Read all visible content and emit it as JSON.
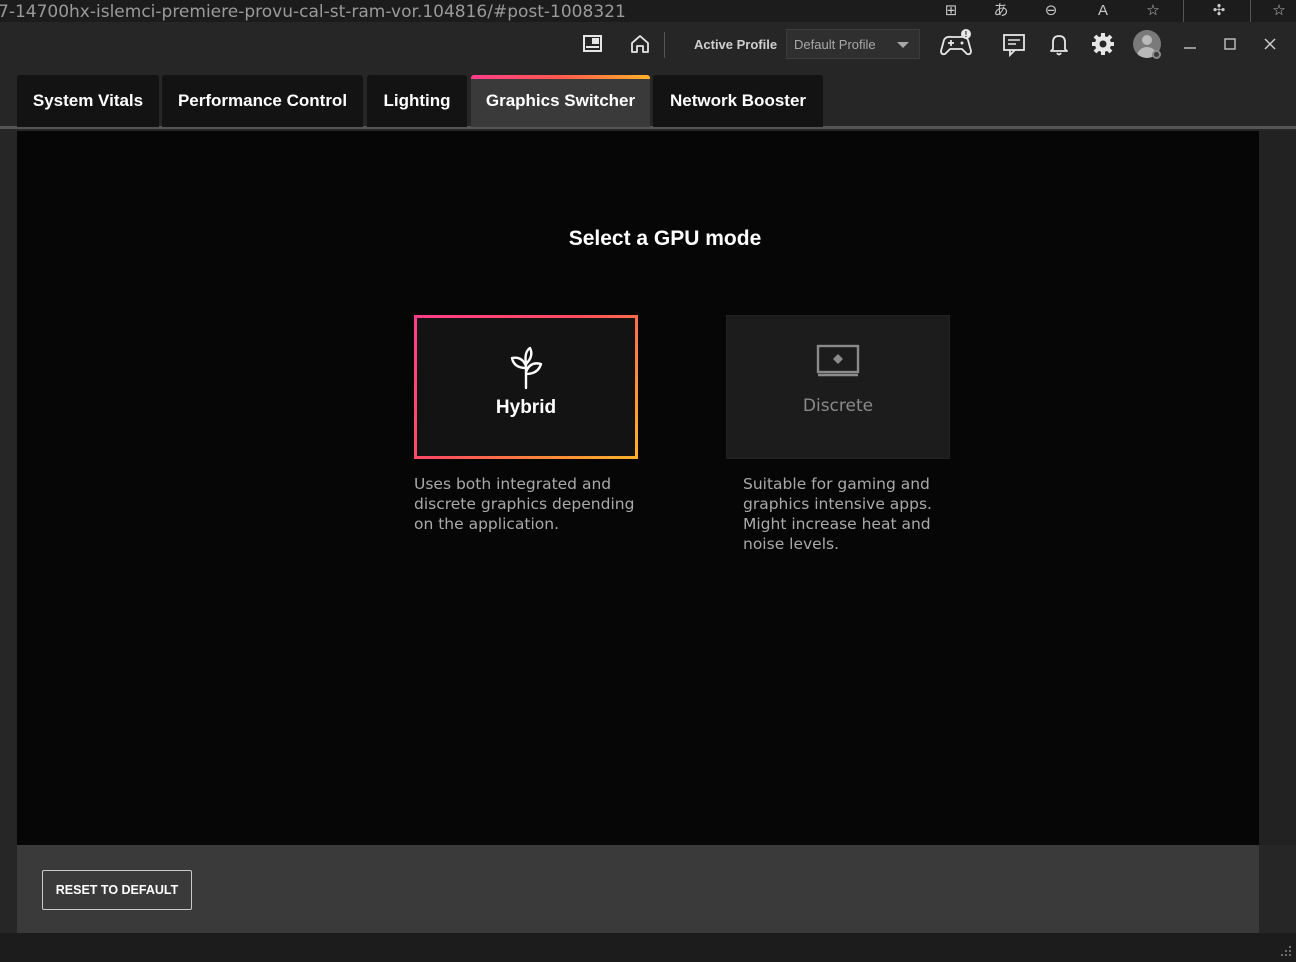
{
  "browser": {
    "url": "7-14700hx-islemci-premiere-provu-cal-st-ram-vor.104816/#post-1008321"
  },
  "titlebar": {
    "active_profile_label": "Active Profile",
    "profile_select_value": "Default Profile"
  },
  "tabs": [
    {
      "label": "System Vitals",
      "active": false
    },
    {
      "label": "Performance Control",
      "active": false
    },
    {
      "label": "Lighting",
      "active": false
    },
    {
      "label": "Graphics Switcher",
      "active": true
    },
    {
      "label": "Network Booster",
      "active": false
    }
  ],
  "main": {
    "heading": "Select a GPU mode",
    "modes": [
      {
        "label": "Hybrid",
        "selected": true,
        "icon": "leaf-icon",
        "description": "Uses both integrated and discrete graphics depending on the application."
      },
      {
        "label": "Discrete",
        "selected": false,
        "icon": "monitor-icon",
        "description": "Suitable for gaming and graphics intensive apps. Might increase heat and noise levels."
      }
    ]
  },
  "footer": {
    "reset_label": "RESET TO DEFAULT"
  },
  "colors": {
    "accent_start": "#ff3d8b",
    "accent_end": "#ffb12a",
    "background": "#060606"
  }
}
